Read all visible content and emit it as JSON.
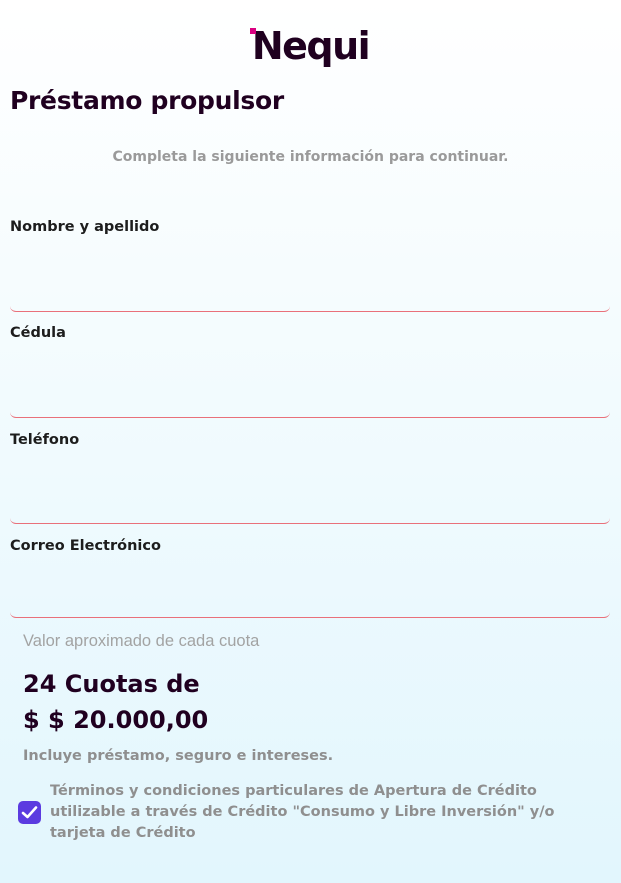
{
  "brand": {
    "logo_text": "Nequi"
  },
  "page": {
    "title": "Préstamo propulsor",
    "subtitle": "Completa la siguiente información para continuar."
  },
  "form": {
    "fields": [
      {
        "label": "Nombre y apellido",
        "value": ""
      },
      {
        "label": "Cédula",
        "value": ""
      },
      {
        "label": "Teléfono",
        "value": ""
      },
      {
        "label": "Correo Electrónico",
        "value": ""
      }
    ],
    "accent_line_color": "#e9707a"
  },
  "quote": {
    "label": "Valor aproximado de cada cuota",
    "installments": "24 Cuotas de",
    "amount": "$ $ 20.000,00",
    "note": "Incluye préstamo, seguro e intereses."
  },
  "terms": {
    "checked": true,
    "text": "Términos y condiciones particulares de Apertura de Crédito utilizable a través de Crédito \"Consumo y Libre Inversión\" y/o tarjeta de Crédito",
    "check_color": "#5b3be0"
  },
  "colors": {
    "brand_dark": "#200020",
    "brand_pink": "#da0081"
  }
}
